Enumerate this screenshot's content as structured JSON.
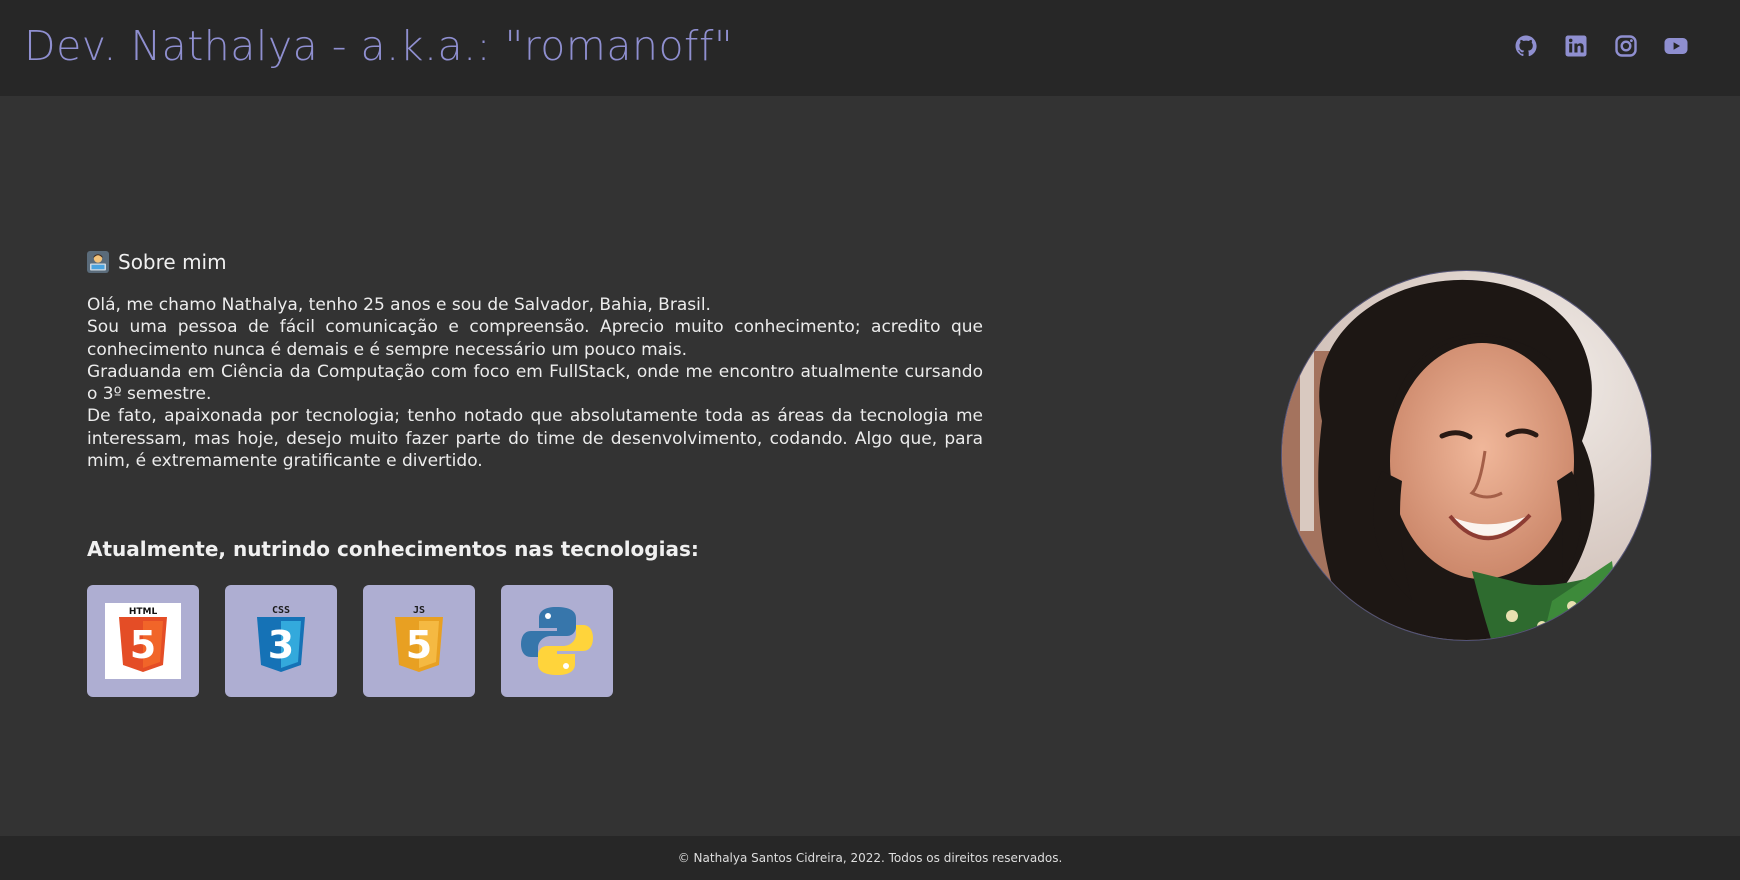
{
  "header": {
    "title": "Dev. Nathalya - a.k.a.: \"romanoff\"",
    "social": [
      {
        "icon": "github-icon"
      },
      {
        "icon": "linkedin-icon"
      },
      {
        "icon": "instagram-icon"
      },
      {
        "icon": "youtube-icon"
      }
    ]
  },
  "about": {
    "heading": "Sobre mim",
    "emoji_icon": "technologist-emoji-icon",
    "paragraphs": [
      "Olá, me chamo Nathalya, tenho 25 anos e sou de Salvador, Bahia, Brasil.",
      "Sou uma pessoa de fácil comunicação e compreensão. Aprecio muito conhecimento; acredito que conhecimento nunca é demais e é sempre necessário um pouco mais.",
      "Graduanda em Ciência da Computação com foco em FullStack, onde me encontro atualmente cursando o 3º semestre.",
      "De fato, apaixonada por tecnologia; tenho notado que absolutamente toda as áreas da tecnologia me interessam, mas hoje, desejo muito fazer parte do time de desenvolvimento, codando. Algo que, para mim, é extremamente gratificante e divertido."
    ]
  },
  "technologies": {
    "heading": "Atualmente, nutrindo conhecimentos nas tecnologias:",
    "items": [
      {
        "icon": "html5-icon",
        "label": "HTML",
        "numeral": "5"
      },
      {
        "icon": "css3-icon",
        "label": "CSS",
        "numeral": "3"
      },
      {
        "icon": "javascript-icon",
        "label": "JS",
        "numeral": "5"
      },
      {
        "icon": "python-icon"
      }
    ]
  },
  "profile": {
    "photo": "profile-photo"
  },
  "footer": {
    "text": "© Nathalya Santos Cidreira, 2022. Todos os direitos reservados."
  },
  "colors": {
    "accent": "#8f8fd0",
    "header_bg": "#272727",
    "page_bg": "#333333",
    "tile_bg": "#aeaed2",
    "html_orange": "#e44d26",
    "css_blue": "#1572b6",
    "js_yellow": "#f0a530",
    "python_blue": "#3776ab",
    "python_yellow": "#ffd43b"
  }
}
